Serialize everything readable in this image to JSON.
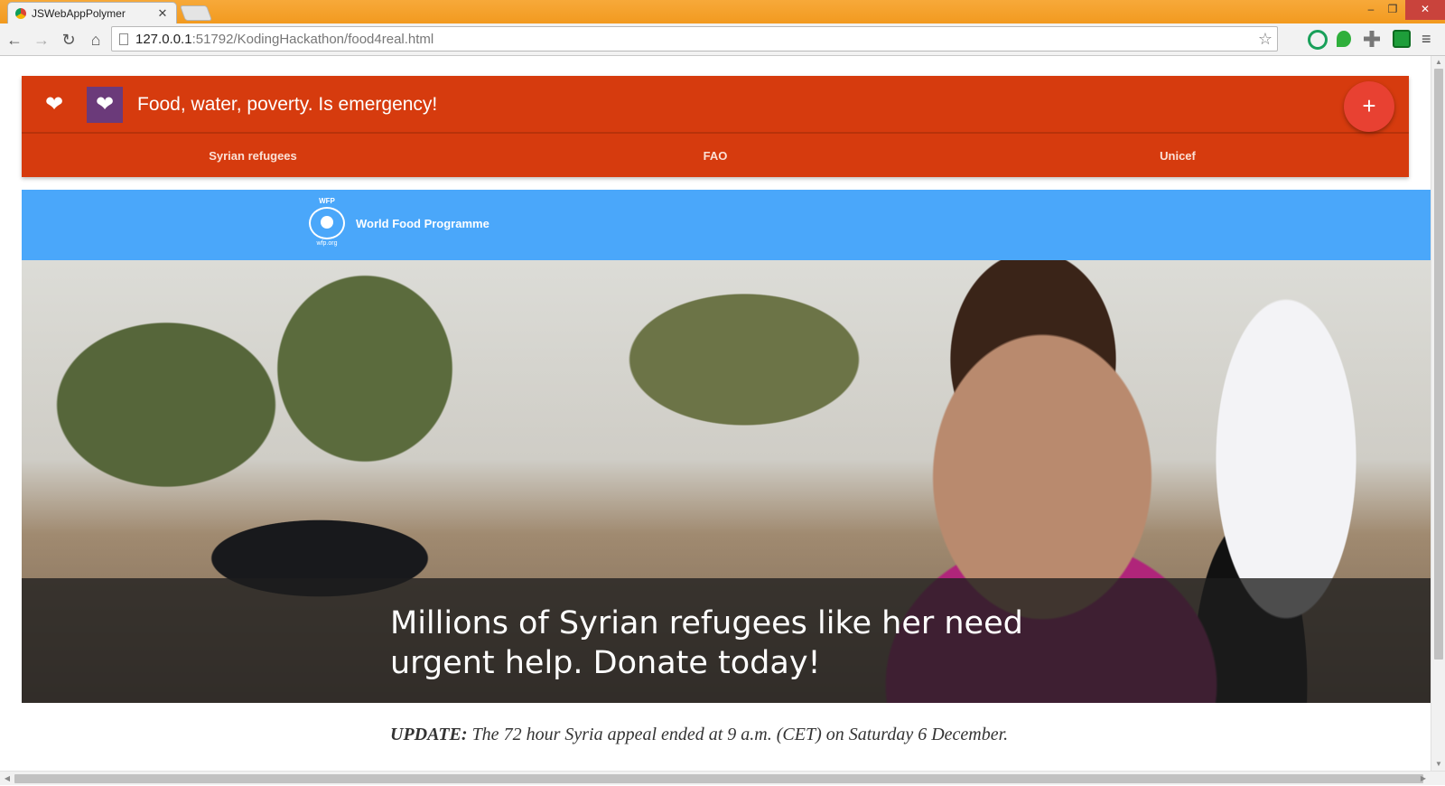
{
  "browser": {
    "tab_title": "JSWebAppPolymer",
    "url_host": "127.0.0.1",
    "url_rest": ":51792/KodingHackathon/food4real.html"
  },
  "app": {
    "title": "Food, water, poverty. Is emergency!",
    "fab_label": "+",
    "tabs": [
      {
        "label": "Syrian refugees"
      },
      {
        "label": "FAO"
      },
      {
        "label": "Unicef"
      }
    ]
  },
  "wfp": {
    "acronym": "WFP",
    "name": "World Food Programme",
    "site": "wfp.org"
  },
  "hero": {
    "caption": "Millions of Syrian refugees like her need urgent help. Donate today!"
  },
  "update": {
    "label": "UPDATE:",
    "text": " The 72 hour Syria appeal ended at 9 a.m. (CET) on Saturday 6 December."
  },
  "colors": {
    "header": "#d63b0e",
    "logo_box": "#6b3a7a",
    "fab": "#e84132",
    "wfp_bar": "#4aa7fa",
    "title_bar": "#f29a1f"
  }
}
